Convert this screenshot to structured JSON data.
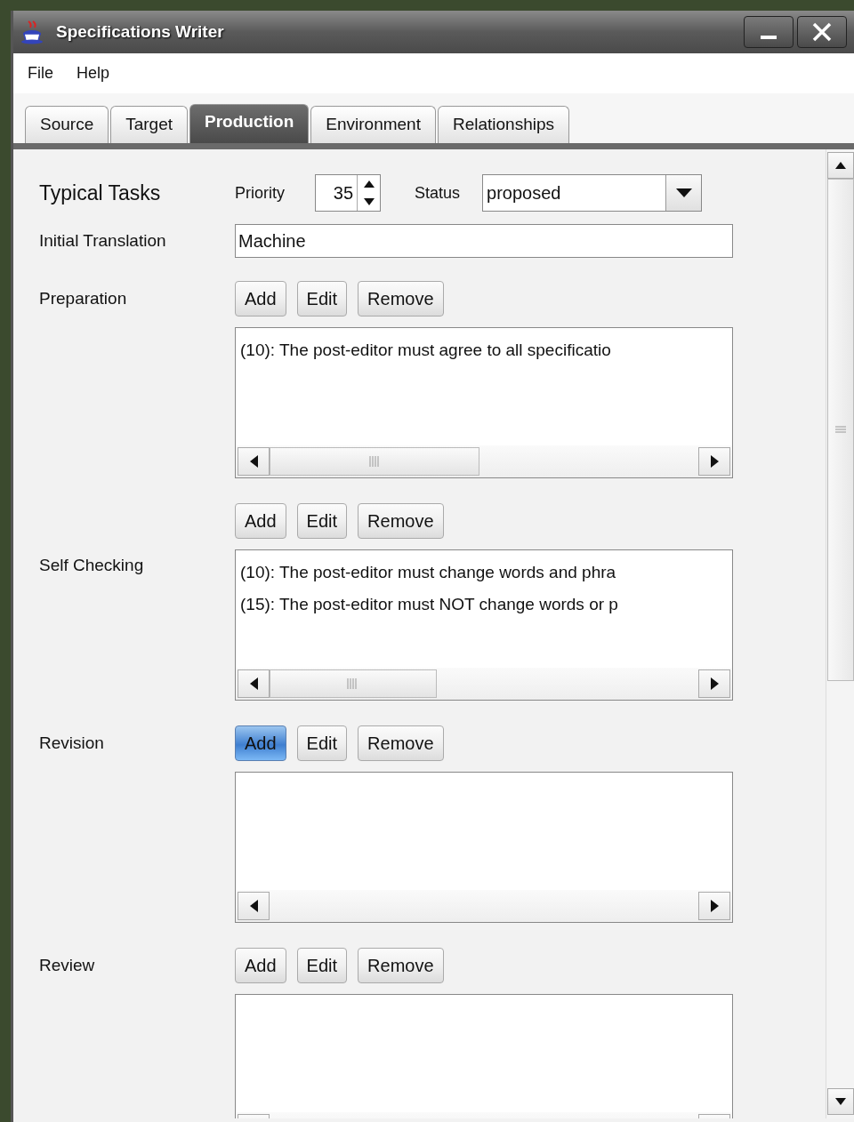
{
  "window": {
    "title": "Specifications Writer"
  },
  "menu": [
    "File",
    "Help"
  ],
  "tabs": [
    {
      "label": "Source",
      "selected": false
    },
    {
      "label": "Target",
      "selected": false
    },
    {
      "label": "Production",
      "selected": true
    },
    {
      "label": "Environment",
      "selected": false
    },
    {
      "label": "Relationships",
      "selected": false
    }
  ],
  "form": {
    "title": "Typical Tasks",
    "priority": {
      "label": "Priority",
      "value": "35"
    },
    "status": {
      "label": "Status",
      "value": "proposed"
    },
    "initial_translation": {
      "label": "Initial Translation",
      "value": "Machine"
    }
  },
  "rows": [
    {
      "kind": "buttons",
      "label": "Preparation",
      "buttons": [
        {
          "label": "Add",
          "focused": false
        },
        {
          "label": "Edit",
          "focused": false
        },
        {
          "label": "Remove",
          "focused": false
        }
      ]
    },
    {
      "kind": "list",
      "items": [
        "(10): The post-editor must agree to all specificatio"
      ],
      "overflow": true
    },
    {
      "kind": "buttons",
      "buttons": [
        {
          "label": "Add",
          "focused": false
        },
        {
          "label": "Edit",
          "focused": false
        },
        {
          "label": "Remove",
          "focused": false
        }
      ]
    },
    {
      "kind": "list",
      "label": "Self Checking",
      "items": [
        "(10): The post-editor must change words and phra",
        "(15): The post-editor must NOT change words or p"
      ],
      "overflow": true
    },
    {
      "kind": "buttons",
      "label": "Revision",
      "buttons": [
        {
          "label": "Add",
          "focused": true
        },
        {
          "label": "Edit",
          "focused": false
        },
        {
          "label": "Remove",
          "focused": false
        }
      ]
    },
    {
      "kind": "list",
      "items": [],
      "overflow": false
    },
    {
      "kind": "buttons",
      "label": "Review",
      "buttons": [
        {
          "label": "Add",
          "focused": false
        },
        {
          "label": "Edit",
          "focused": false
        },
        {
          "label": "Remove",
          "focused": false
        }
      ]
    },
    {
      "kind": "list",
      "items": [],
      "overflow": false
    }
  ]
}
